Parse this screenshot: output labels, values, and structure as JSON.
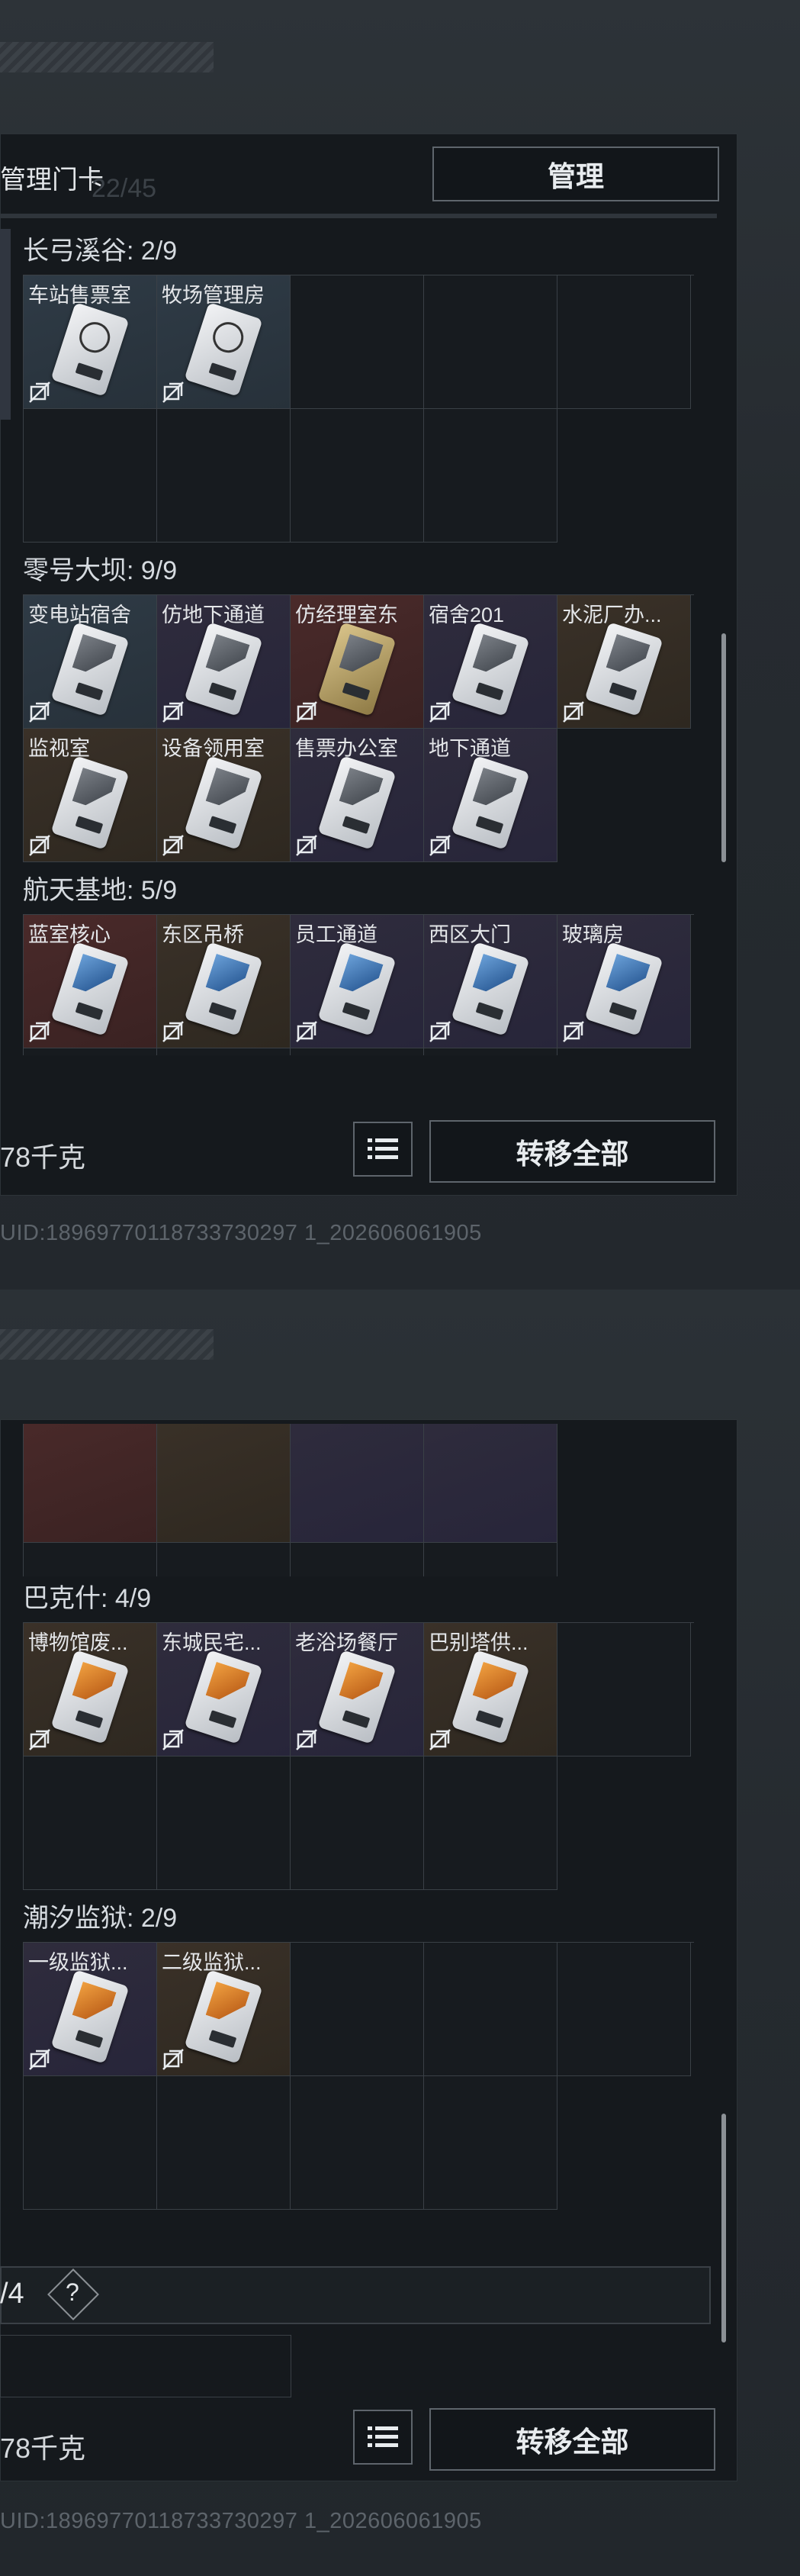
{
  "top": {
    "header_label": "管理门卡",
    "manage_button": "管理",
    "faint_counter": "22/45",
    "sections": [
      {
        "title": "长弓溪谷: 2/9",
        "items": [
          {
            "label": "车站售票室",
            "color": "bluegrey",
            "card": "sym"
          },
          {
            "label": "牧场管理房",
            "color": "bluegrey",
            "card": "sym"
          }
        ]
      },
      {
        "title": "零号大坝: 9/9",
        "items": [
          {
            "label": "变电站宿舍",
            "color": "bluegrey",
            "card": "grey"
          },
          {
            "label": "仿地下通道",
            "color": "purple",
            "card": "grey"
          },
          {
            "label": "仿经理室东",
            "color": "red",
            "card": "gold"
          },
          {
            "label": "宿舍201",
            "color": "purple",
            "card": "grey"
          },
          {
            "label": "水泥厂办...",
            "color": "brown",
            "card": "grey"
          },
          {
            "label": "监视室",
            "color": "brown",
            "card": "grey"
          },
          {
            "label": "设备领用室",
            "color": "brown",
            "card": "grey"
          },
          {
            "label": "售票办公室",
            "color": "purple",
            "card": "grey"
          },
          {
            "label": "地下通道",
            "color": "purple",
            "card": "grey"
          }
        ]
      },
      {
        "title": "航天基地: 5/9",
        "items": [
          {
            "label": "蓝室核心",
            "color": "red",
            "card": "blue"
          },
          {
            "label": "东区吊桥",
            "color": "brown",
            "card": "blue"
          },
          {
            "label": "员工通道",
            "color": "purple",
            "card": "blue"
          },
          {
            "label": "西区大门",
            "color": "purple",
            "card": "blue"
          },
          {
            "label": "玻璃房",
            "color": "purple",
            "card": "blue"
          }
        ]
      }
    ],
    "weight": "78千克",
    "transfer_all": "转移全部",
    "uid": "UID:18969770118733730297 1_202606061905"
  },
  "bottom": {
    "sections": [
      {
        "title": "巴克什: 4/9",
        "items": [
          {
            "label": "博物馆废...",
            "color": "brown",
            "card": "orange"
          },
          {
            "label": "东城民宅...",
            "color": "purple",
            "card": "orange"
          },
          {
            "label": "老浴场餐厅",
            "color": "purple",
            "card": "orange"
          },
          {
            "label": "巴别塔供...",
            "color": "brown",
            "card": "orange"
          }
        ]
      },
      {
        "title": "潮汐监狱: 2/9",
        "items": [
          {
            "label": "一级监狱...",
            "color": "purple",
            "card": "orange"
          },
          {
            "label": "二级监狱...",
            "color": "brown",
            "card": "orange"
          }
        ]
      }
    ],
    "next_counter": "/4",
    "help_icon": "?",
    "weight": "78千克",
    "transfer_all": "转移全部",
    "uid": "UID:18969770118733730297 1_202606061905"
  }
}
